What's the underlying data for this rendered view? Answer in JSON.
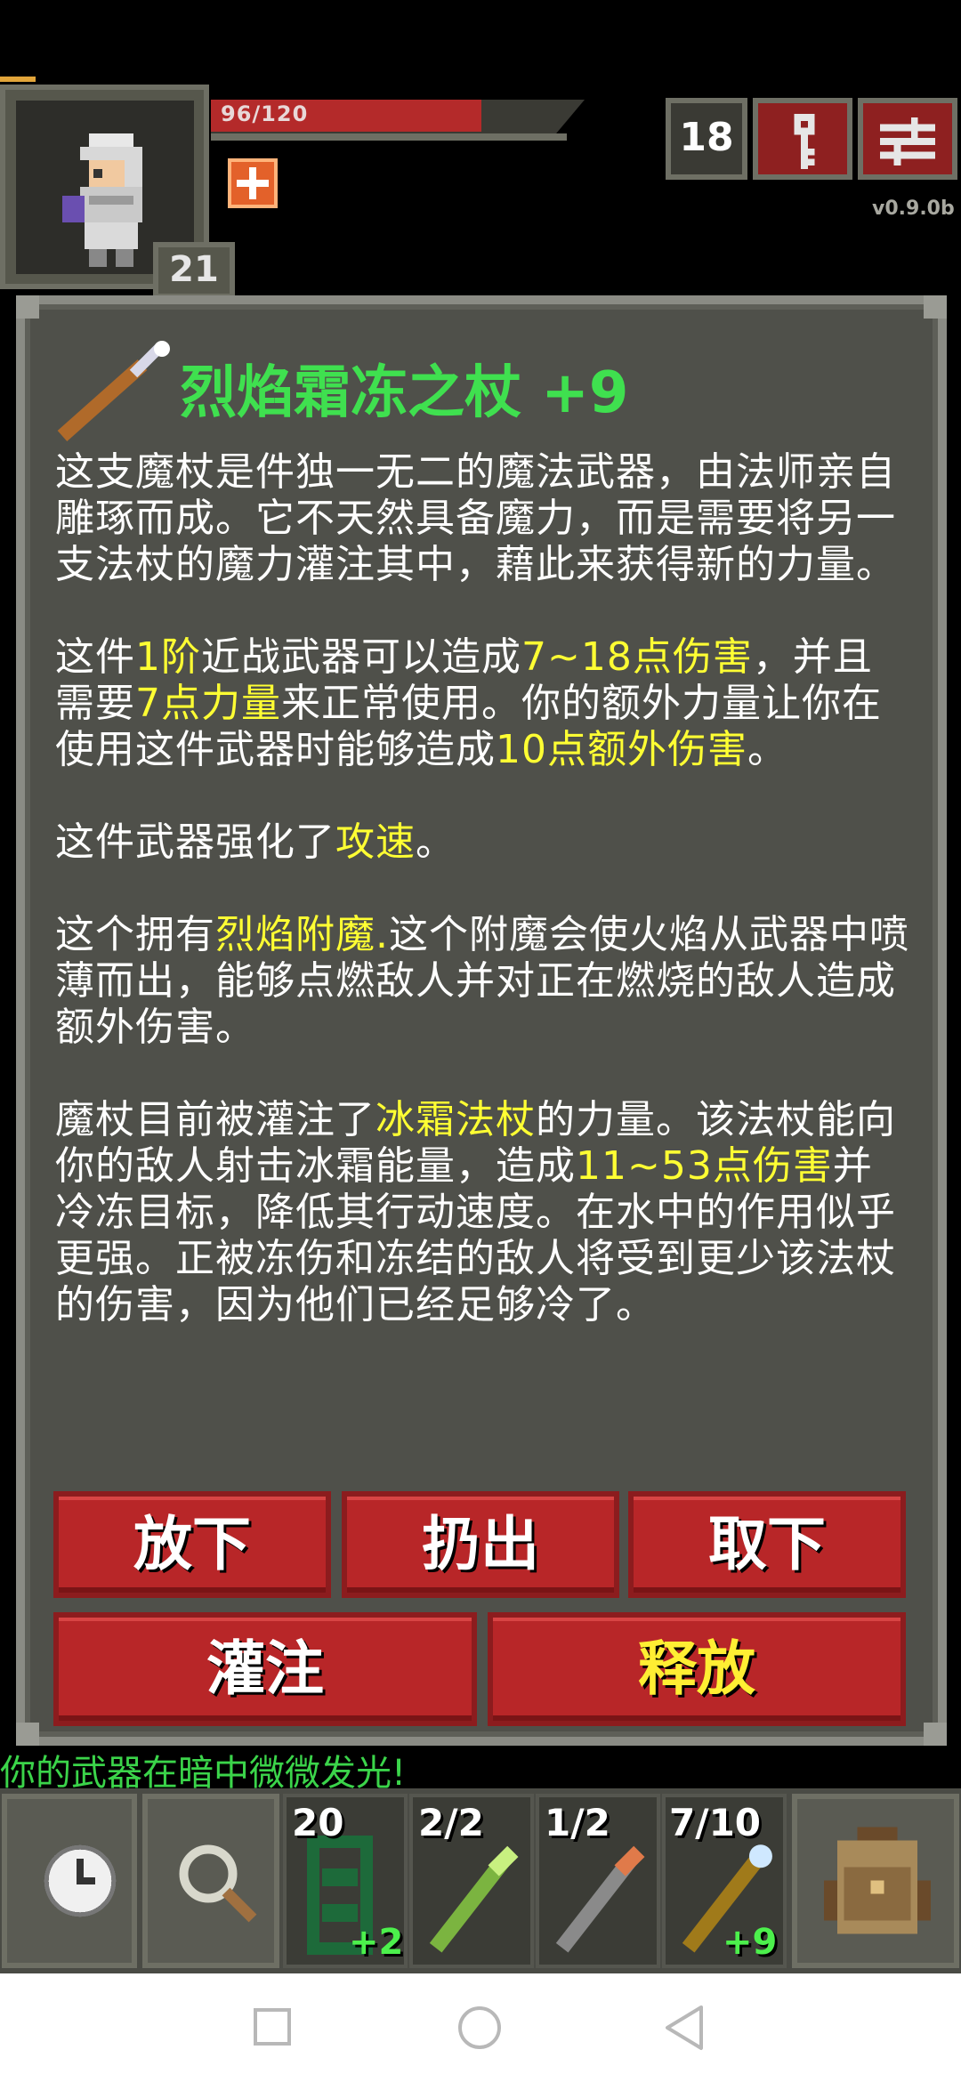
{
  "status": {
    "hp_text": "96/120",
    "hp_fraction": 0.8,
    "hero_level": "21",
    "dungeon_depth": "18",
    "version": "v0.9.0b"
  },
  "item": {
    "title": "烈焰霜冻之杖 +9",
    "paragraphs": [
      [
        {
          "t": "这支魔杖是件独一无二的魔法武器，由法师亲自雕琢而成。它不天然具备魔力，而是需要将另一支法杖的魔力灌注其中，藉此来获得新的力量。"
        }
      ],
      [
        {
          "t": "这件"
        },
        {
          "t": "1阶",
          "hl": true
        },
        {
          "t": "近战武器可以造成"
        },
        {
          "t": "7~18点伤害",
          "hl": true
        },
        {
          "t": "，并且需要"
        },
        {
          "t": "7点力量",
          "hl": true
        },
        {
          "t": "来正常使用。你的额外力量让你在使用这件武器时能够造成"
        },
        {
          "t": "10点额外伤害",
          "hl": true
        },
        {
          "t": "。"
        }
      ],
      [
        {
          "t": "这件武器强化了"
        },
        {
          "t": "攻速",
          "hl": true
        },
        {
          "t": "。"
        }
      ],
      [
        {
          "t": "这个拥有"
        },
        {
          "t": "烈焰附魔.",
          "hl": true
        },
        {
          "t": "这个附魔会使火焰从武器中喷薄而出，能够点燃敌人并对正在燃烧的敌人造成额外伤害。"
        }
      ],
      [
        {
          "t": "魔杖目前被灌注了"
        },
        {
          "t": "冰霜法杖",
          "hl": true
        },
        {
          "t": "的力量。该法杖能向你的敌人射击冰霜能量，造成"
        },
        {
          "t": "11~53点伤害",
          "hl": true
        },
        {
          "t": "并冷冻目标，降低其行动速度。在水中的作用似乎更强。正被冻伤和冻结的敌人将受到更少该法杖的伤害，因为他们已经足够冷了。"
        }
      ]
    ]
  },
  "actions": {
    "drop": "放下",
    "throw": "扔出",
    "unequip": "取下",
    "imbue": "灌注",
    "release": "释放"
  },
  "log": {
    "line": "你的武器在暗中微微发光!"
  },
  "quickslots": [
    {
      "count": "20",
      "plus": "+2",
      "icon": "green-vine-icon"
    },
    {
      "count": "2/2",
      "plus": "",
      "icon": "green-wand-icon"
    },
    {
      "count": "1/2",
      "plus": "",
      "icon": "gray-wand-icon"
    },
    {
      "count": "7/10",
      "plus": "+9",
      "icon": "frost-staff-icon"
    }
  ],
  "colors": {
    "highlight": "#ffff33",
    "title": "#3fe04f",
    "button": "#b82628",
    "panel": "#4f504a"
  }
}
